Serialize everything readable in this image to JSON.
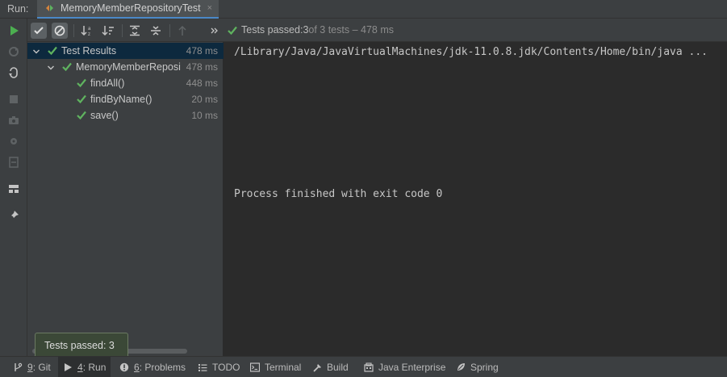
{
  "run_bar": {
    "label": "Run:",
    "tab_title": "MemoryMemberRepositoryTest",
    "tab_icon": "test-runner-icon",
    "close_glyph": "×"
  },
  "left_tools": [
    {
      "name": "rerun-icon",
      "color": "#4caf50"
    },
    {
      "name": "rerun-failed-icon"
    },
    {
      "name": "toggle-auto-test-icon"
    },
    {
      "name": "stop-icon"
    },
    {
      "name": "screenshot-icon"
    },
    {
      "name": "debug-settings-icon"
    },
    {
      "name": "exit-icon"
    },
    {
      "name": "layout-icon"
    },
    {
      "name": "pin-icon"
    }
  ],
  "toolbar": {
    "buttons": [
      {
        "name": "show-passed-icon",
        "active": true
      },
      {
        "name": "show-ignored-icon",
        "active": true
      },
      {
        "name": "sort-alphabetically-icon"
      },
      {
        "name": "sort-by-duration-icon"
      },
      {
        "name": "expand-all-icon"
      },
      {
        "name": "collapse-all-icon"
      },
      {
        "name": "previous-failed-icon"
      },
      {
        "name": "more-chevron-icon"
      }
    ],
    "status_prefix": "Tests passed: ",
    "status_count": "3",
    "status_suffix": " of 3 tests – 478 ms"
  },
  "tree": {
    "rows": [
      {
        "name": "Test Results",
        "time": "478 ms"
      },
      {
        "name": "MemoryMemberReposi",
        "time": "478 ms"
      },
      {
        "name": "findAll()",
        "time": "448 ms"
      },
      {
        "name": "findByName()",
        "time": "20 ms"
      },
      {
        "name": "save()",
        "time": "10 ms"
      }
    ]
  },
  "console": {
    "lines": [
      "/Library/Java/JavaVirtualMachines/jdk-11.0.8.jdk/Contents/Home/bin/java ...",
      "Process finished with exit code 0"
    ]
  },
  "tooltip": {
    "text": "Tests passed: 3"
  },
  "bottom_bar": {
    "items": [
      {
        "icon": "git-branch-icon",
        "key": "9",
        "label": ": Git"
      },
      {
        "icon": "run-icon",
        "key": "4",
        "label": ": Run"
      },
      {
        "icon": "problems-icon",
        "key": "6",
        "label": ": Problems"
      },
      {
        "icon": "todo-icon",
        "key": "",
        "label": "TODO"
      },
      {
        "icon": "terminal-icon",
        "key": "",
        "label": "Terminal"
      },
      {
        "icon": "build-icon",
        "key": "",
        "label": "Build"
      },
      {
        "icon": "java-enterprise-icon",
        "key": "",
        "label": "Java Enterprise"
      },
      {
        "icon": "spring-icon",
        "key": "",
        "label": "Spring"
      }
    ]
  },
  "colors": {
    "pass_green": "#5fb35f",
    "accent_blue": "#4a88c7",
    "selection": "#0d293e"
  }
}
